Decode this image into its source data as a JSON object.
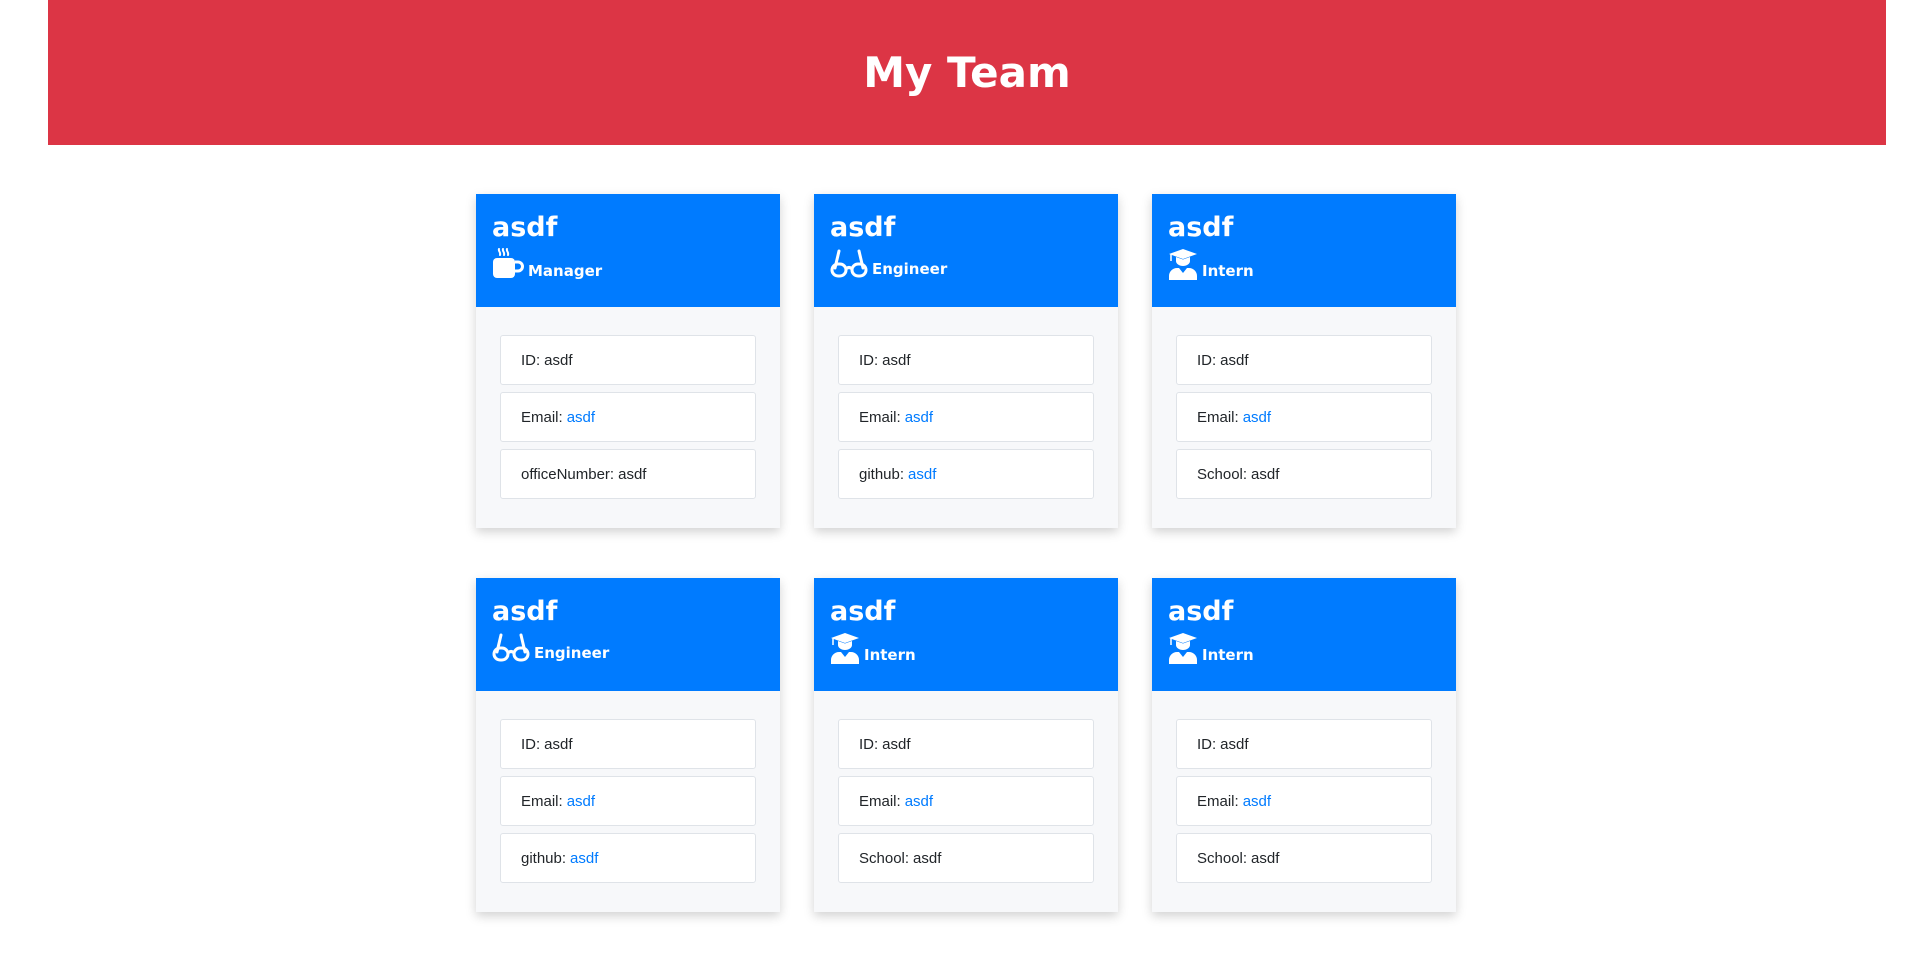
{
  "header": {
    "title": "My Team"
  },
  "cards": [
    {
      "name": "asdf",
      "role": "Manager",
      "icon": "coffee-mug-icon",
      "id_label": "ID:",
      "id_value": "asdf",
      "email_label": "Email:",
      "email_value": "asdf",
      "extra_label": "officeNumber:",
      "extra_value": "asdf"
    },
    {
      "name": "asdf",
      "role": "Engineer",
      "icon": "glasses-icon",
      "id_label": "ID:",
      "id_value": "asdf",
      "email_label": "Email:",
      "email_value": "asdf",
      "extra_label": "github:",
      "extra_value": "asdf"
    },
    {
      "name": "asdf",
      "role": "Intern",
      "icon": "graduate-icon",
      "id_label": "ID:",
      "id_value": "asdf",
      "email_label": "Email:",
      "email_value": "asdf",
      "extra_label": "School:",
      "extra_value": "asdf"
    },
    {
      "name": "asdf",
      "role": "Engineer",
      "icon": "glasses-icon",
      "id_label": "ID:",
      "id_value": "asdf",
      "email_label": "Email:",
      "email_value": "asdf",
      "extra_label": "github:",
      "extra_value": "asdf"
    },
    {
      "name": "asdf",
      "role": "Intern",
      "icon": "graduate-icon",
      "id_label": "ID:",
      "id_value": "asdf",
      "email_label": "Email:",
      "email_value": "asdf",
      "extra_label": "School:",
      "extra_value": "asdf"
    },
    {
      "name": "asdf",
      "role": "Intern",
      "icon": "graduate-icon",
      "id_label": "ID:",
      "id_value": "asdf",
      "email_label": "Email:",
      "email_value": "asdf",
      "extra_label": "School:",
      "extra_value": "asdf"
    }
  ],
  "colors": {
    "header_bg": "#dc3545",
    "card_header_bg": "#007bff",
    "link": "#007bff",
    "card_body_bg": "#f7f8fa"
  }
}
